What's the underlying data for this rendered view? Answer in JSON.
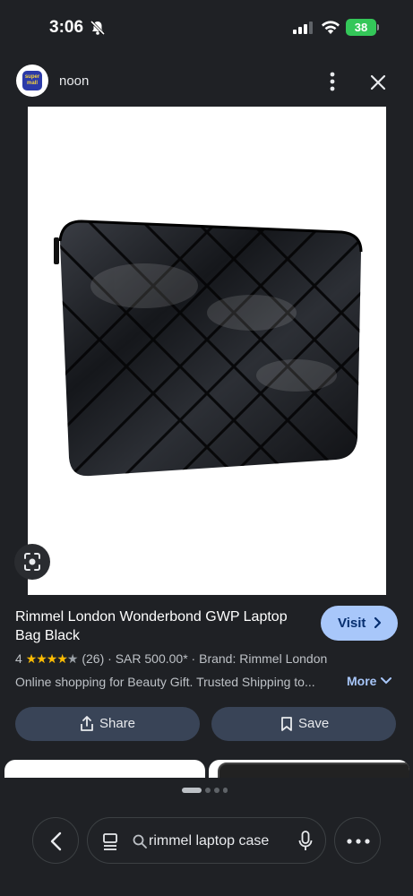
{
  "status_bar": {
    "time": "3:06",
    "battery": "38"
  },
  "header": {
    "site_name": "noon",
    "logo_text": "super mall"
  },
  "product": {
    "title": "Rimmel London Wonderbond GWP Laptop Bag Black",
    "rating": "4",
    "rating_value": 4,
    "review_count": "(26)",
    "price": "SAR 500.00*",
    "brand": "Brand: Rimmel London",
    "description": "Online shopping for Beauty Gift. Trusted Shipping to...",
    "more_label": "More"
  },
  "actions": {
    "visit_label": "Visit",
    "share_label": "Share",
    "save_label": "Save"
  },
  "search": {
    "query": "rimmel laptop case"
  },
  "icons": [
    "bell-slash-icon",
    "signal-icon",
    "wifi-icon",
    "battery-icon",
    "more-vert-icon",
    "close-icon",
    "lens-icon",
    "chevron-right-icon",
    "share-icon",
    "bookmark-icon",
    "chevron-down-icon",
    "back-icon",
    "tabs-icon",
    "search-icon",
    "mic-icon",
    "more-horiz-icon"
  ],
  "colors": {
    "background": "#1f2125",
    "accent": "#a8c7fa",
    "button": "#394457",
    "star": "#fbbc04"
  }
}
